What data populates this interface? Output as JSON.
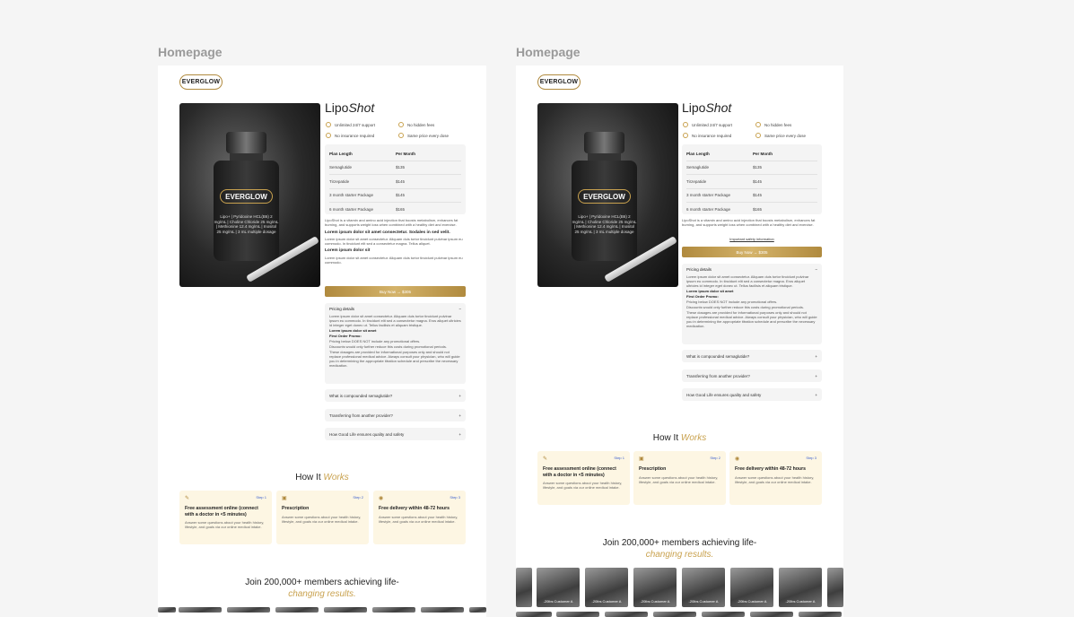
{
  "frames": [
    {
      "title": "Homepage",
      "logo": "EVERGLOW",
      "product": {
        "title_main": "Lipo",
        "title_italic": "Shot",
        "vial_brand": "EVERGLOW",
        "vial_text": "Lipo+ | Pyridoxine HCL(B6) 2 mg/mL | Choline Chloride 25 mg/mL | Methionine 12.4 mg/mL | Inositol 25 mg/mL | 3 mL multiple dosage"
      },
      "features": [
        "Unlimited 24/7 support",
        "No hidden fees",
        "No insurance required",
        "Same price every dose"
      ],
      "pricing": {
        "headers": [
          "Plan Length",
          "Per Month"
        ],
        "rows": [
          [
            "Semaglutide",
            "$135"
          ],
          [
            "Tirzepatide",
            "$145"
          ],
          [
            "3 month starter Package",
            "$145"
          ],
          [
            "6 month starter Package",
            "$165"
          ]
        ]
      },
      "description": "LipoShot is a vitamin and amino acid injection that boosts metabolism, enhances fat burning, and supports weight loss when combined with a healthy diet and exercise.",
      "lorem_heading_1": "Lorem ipsum dolor sit amet consectetur. Sodales in sed velit.",
      "lorem_text_1": "Lorem ipsum dolor sit amet consectetur. Aliquam duis tortor tincidunt pulvinar ipsum eu commodo. In tincidunt elit sed a consectetur magna. Tellus aliquet.",
      "lorem_heading_2": "Lorem ipsum dolor sit",
      "lorem_text_2": "Lorem ipsum dolor sit amet consectetur. Aliquam duis tortor tincidunt pulvinar ipsum eu commodo.",
      "buy_label": "Buy Now  →  $305",
      "pricing_details": {
        "title": "Pricing details",
        "text1": "Lorem ipsum dolor sit amet consectetur. Aliquam duis tortor tincidunt pulvinar ipsum eu commodo. In tincidunt elit sed a consectetur magna. Eros aliquet ultricies id integer eget donec ut. Tellus facilisis et aliquam tristique.",
        "sub1": "Lorem ipsum dolor sit amet",
        "sub2": "First Order Promo:",
        "text2": "Pricing below DOES NOT include any promotional offers.",
        "text3": "Discounts would only further reduce this costs during promotional periods.",
        "text4": "These dosages are provided for informational purposes only and should not replace professional medical advice. Always consult your physician, who will guide you in determining the appropriate titration schedule and prescribe the necessary medication."
      },
      "questions": [
        "What is compounded semaglutide?",
        "Transferring from another provider?",
        "How Good Life ensures quality and safety"
      ],
      "how": {
        "main": "How It ",
        "italic": "Works"
      },
      "steps": [
        {
          "num": "Step 1",
          "title": "Free assessment online (connect with a doctor in <5 minutes)",
          "desc": "Answer some questions about your health history, lifestyle, and goals via our online medical intake."
        },
        {
          "num": "Step 2",
          "title": "Prescription",
          "desc": "Answer some questions about your health history, lifestyle, and goals via our online medical intake."
        },
        {
          "num": "Step 3",
          "title": "Free delivery within 48-72 hours",
          "desc": "Answer some questions about your health history, lifestyle, and goals via our online medical intake."
        }
      ],
      "join": {
        "main": "Join 200,000+ members achieving life-",
        "italic": "changing results."
      }
    },
    {
      "title": "Homepage",
      "logo": "EVERGLOW",
      "product": {
        "title_main": "Lipo",
        "title_italic": "Shot"
      },
      "features": [
        "Unlimited 24/7 support",
        "No hidden fees",
        "No insurance required",
        "Same price every dose"
      ],
      "pricing": {
        "headers": [
          "Plan Length",
          "Per Month"
        ],
        "rows": [
          [
            "Semaglutide",
            "$135"
          ],
          [
            "Tirzepatide",
            "$145"
          ],
          [
            "3 month starter Package",
            "$145"
          ],
          [
            "6 month starter Package",
            "$165"
          ]
        ]
      },
      "description": "LipoShot is a vitamin and amino acid injection that boosts metabolism, enhances fat burning, and supports weight loss when combined with a healthy diet and exercise.",
      "safety_link": "Important safety information",
      "buy_label": "Buy Now  →  $305",
      "pricing_details": {
        "title": "Pricing details",
        "text1": "Lorem ipsum dolor sit amet consectetur. Aliquam duis tortor tincidunt pulvinar ipsum eu commodo. In tincidunt elit sed a consectetur magna. Eros aliquet ultricies id integer eget donec ut. Tellus facilisis et aliquam tristique.",
        "sub1": "Lorem ipsum dolor sit amet",
        "sub2": "First Order Promo:",
        "text2": "Pricing below DOES NOT include any promotional offers.",
        "text3": "Discounts would only further reduce this costs during promotional periods.",
        "text4": "These dosages are provided for informational purposes only and should not replace professional medical advice. Always consult your physician, who will guide you in determining the appropriate titration schedule and prescribe the necessary medication."
      },
      "questions": [
        "What is compounded semaglutide?",
        "Transferring from another provider?",
        "How Good Life ensures quality and safety"
      ],
      "how": {
        "main": "How It ",
        "italic": "Works"
      },
      "steps": [
        {
          "num": "Step 1",
          "title": "Free assessment online (connect with a doctor in <5 minutes)",
          "desc": "Answer some questions about your health history, lifestyle, and goals via our online medical intake."
        },
        {
          "num": "Step 2",
          "title": "Prescription",
          "desc": "Answer some questions about your health history, lifestyle, and goals via our online medical intake."
        },
        {
          "num": "Step 3",
          "title": "Free delivery within 48-72 hours",
          "desc": "Answer some questions about your health history, lifestyle, and goals via our online medical intake."
        }
      ],
      "join": {
        "main": "Join 200,000+ members achieving life-",
        "italic": "changing results."
      },
      "testimonial_caption": "-20lbs Customer A"
    }
  ]
}
